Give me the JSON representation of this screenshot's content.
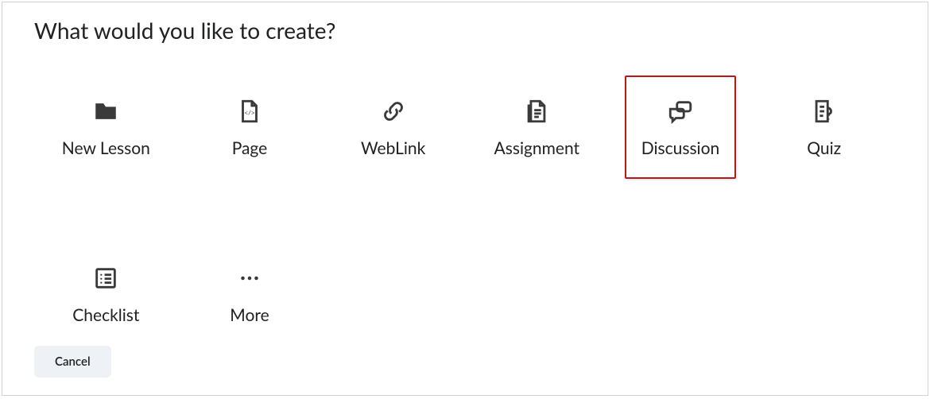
{
  "dialog": {
    "title": "What would you like to create?",
    "cancel_label": "Cancel"
  },
  "options": {
    "new_lesson": {
      "label": "New Lesson",
      "selected": false
    },
    "page": {
      "label": "Page",
      "selected": false
    },
    "weblink": {
      "label": "WebLink",
      "selected": false
    },
    "assignment": {
      "label": "Assignment",
      "selected": false
    },
    "discussion": {
      "label": "Discussion",
      "selected": true
    },
    "quiz": {
      "label": "Quiz",
      "selected": false
    },
    "checklist": {
      "label": "Checklist",
      "selected": false
    },
    "more": {
      "label": "More",
      "selected": false
    }
  },
  "colors": {
    "highlight": "#b31b1b",
    "cancel_bg": "#eef1f5"
  }
}
